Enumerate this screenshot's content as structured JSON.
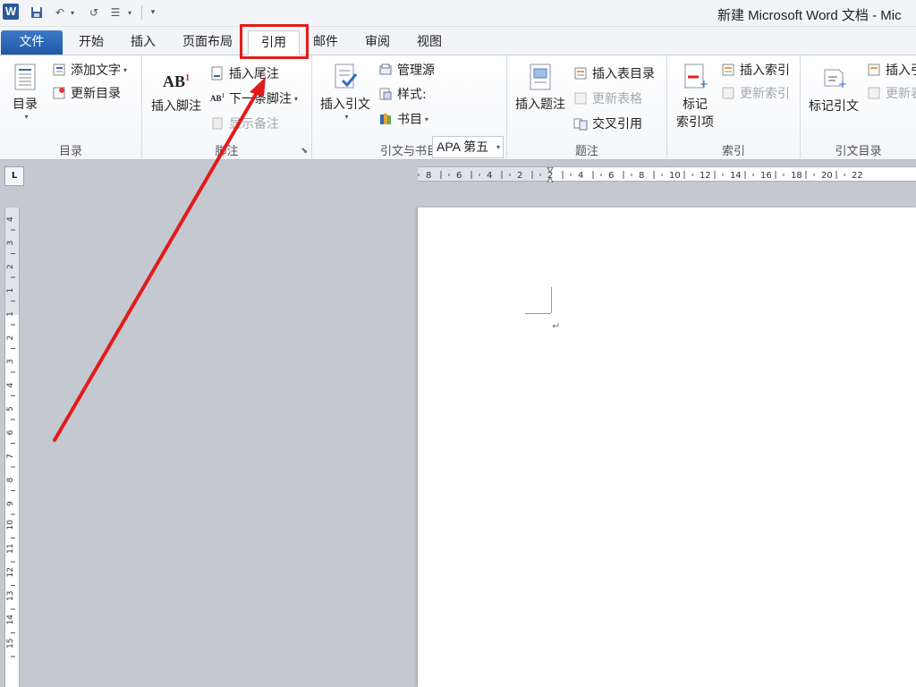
{
  "window": {
    "title": "新建 Microsoft Word 文档 - Mic"
  },
  "quick_access": {
    "app_icon": "W"
  },
  "tabs": [
    {
      "label": "文件"
    },
    {
      "label": "开始"
    },
    {
      "label": "插入"
    },
    {
      "label": "页面布局"
    },
    {
      "label": "引用"
    },
    {
      "label": "邮件"
    },
    {
      "label": "审阅"
    },
    {
      "label": "视图"
    }
  ],
  "ribbon": {
    "toc": {
      "big": "目录",
      "add_text": "添加文字",
      "update": "更新目录",
      "label": "目录"
    },
    "footnotes": {
      "insert_footnote": "插入脚注",
      "insert_endnote": "插入尾注",
      "next_footnote": "下一条脚注",
      "show_notes": "显示备注",
      "label": "脚注"
    },
    "citations": {
      "insert_citation": "插入引文",
      "manage_sources": "管理源",
      "style_label": "样式:",
      "style_value": "APA 第五",
      "bibliography": "书目",
      "label": "引文与书目"
    },
    "captions": {
      "insert_caption": "插入题注",
      "insert_table_of_figures": "插入表目录",
      "update_table": "更新表格",
      "cross_reference": "交叉引用",
      "label": "题注"
    },
    "index": {
      "mark_entry_1": "标记",
      "mark_entry_2": "索引项",
      "insert_index": "插入索引",
      "update_index": "更新索引",
      "label": "索引"
    },
    "toa": {
      "mark_citation": "标记引文",
      "insert_toa": "插入引",
      "update_toa": "更新表",
      "label": "引文目录"
    }
  },
  "rulers": {
    "horizontal_ticks": [
      "8",
      "6",
      "4",
      "2",
      "2",
      "4",
      "6",
      "8",
      "10",
      "12",
      "14",
      "16",
      "18",
      "20",
      "22"
    ],
    "vertical_ticks": [
      "4",
      "3",
      "2",
      "1",
      "1",
      "2",
      "3",
      "4",
      "5",
      "6",
      "7",
      "8",
      "9",
      "10",
      "11",
      "12",
      "13",
      "14",
      "15"
    ]
  },
  "annotation": {
    "color": "#e21b1b"
  },
  "colors": {
    "file_tab": "#2b5797",
    "workspace": "#c3c8d1",
    "page": "#ffffff"
  }
}
